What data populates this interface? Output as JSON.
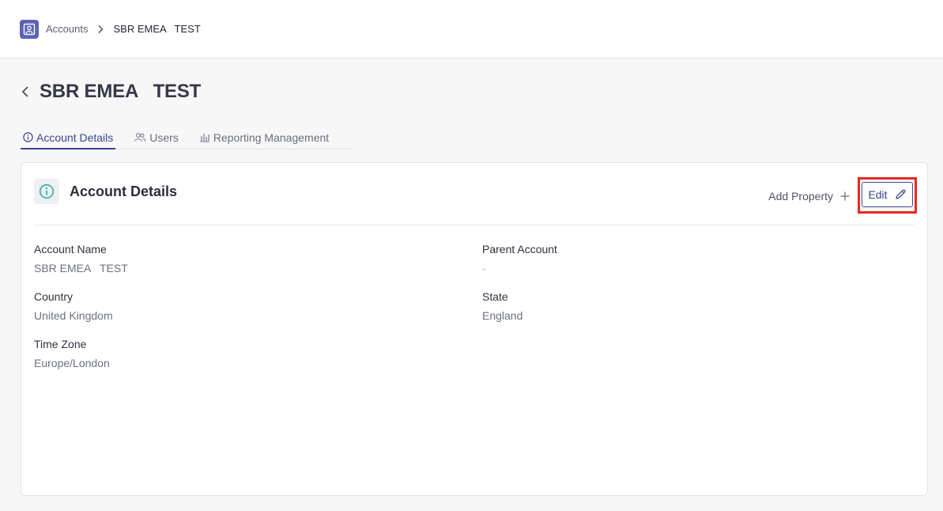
{
  "breadcrumb": {
    "root": "Accounts",
    "current": "SBR EMEA   TEST"
  },
  "page": {
    "title": "SBR EMEA   TEST"
  },
  "tabs": [
    {
      "label": "Account Details",
      "icon": "info-icon",
      "active": true
    },
    {
      "label": "Users",
      "icon": "users-icon",
      "active": false
    },
    {
      "label": "Reporting Management",
      "icon": "bar-chart-icon",
      "active": false
    }
  ],
  "card": {
    "title": "Account Details",
    "add_property_label": "Add Property",
    "edit_label": "Edit"
  },
  "fields": {
    "account_name": {
      "label": "Account Name",
      "value": "SBR EMEA   TEST"
    },
    "parent_account": {
      "label": "Parent Account",
      "value": "-"
    },
    "country": {
      "label": "Country",
      "value": "United Kingdom"
    },
    "state": {
      "label": "State",
      "value": "England"
    },
    "time_zone": {
      "label": "Time Zone",
      "value": "Europe/London"
    }
  },
  "colors": {
    "accent": "#3a468e",
    "highlight": "#e8291b",
    "info_icon": "#2bb3a6"
  }
}
